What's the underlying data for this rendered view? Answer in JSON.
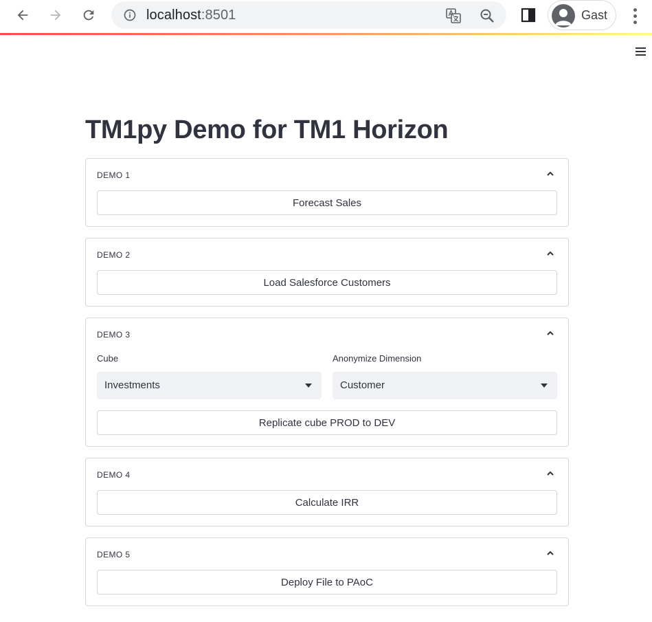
{
  "browser": {
    "url_host": "localhost",
    "url_port": ":8501",
    "profile_name": "Gast"
  },
  "page": {
    "title": "TM1py Demo for TM1 Horizon"
  },
  "demos": [
    {
      "label": "DEMO 1",
      "button": "Forecast Sales"
    },
    {
      "label": "DEMO 2",
      "button": "Load Salesforce Customers"
    },
    {
      "label": "DEMO 3",
      "cube_label": "Cube",
      "cube_value": "Investments",
      "dimension_label": "Anonymize Dimension",
      "dimension_value": "Customer",
      "button": "Replicate cube PROD to DEV"
    },
    {
      "label": "DEMO 4",
      "button": "Calculate IRR"
    },
    {
      "label": "DEMO 5",
      "button": "Deploy File to PAoC"
    }
  ],
  "colors": {
    "text": "#31333f",
    "border": "#d6d6d9",
    "select_bg": "#f0f2f6",
    "accent": "#ff4b4b"
  }
}
